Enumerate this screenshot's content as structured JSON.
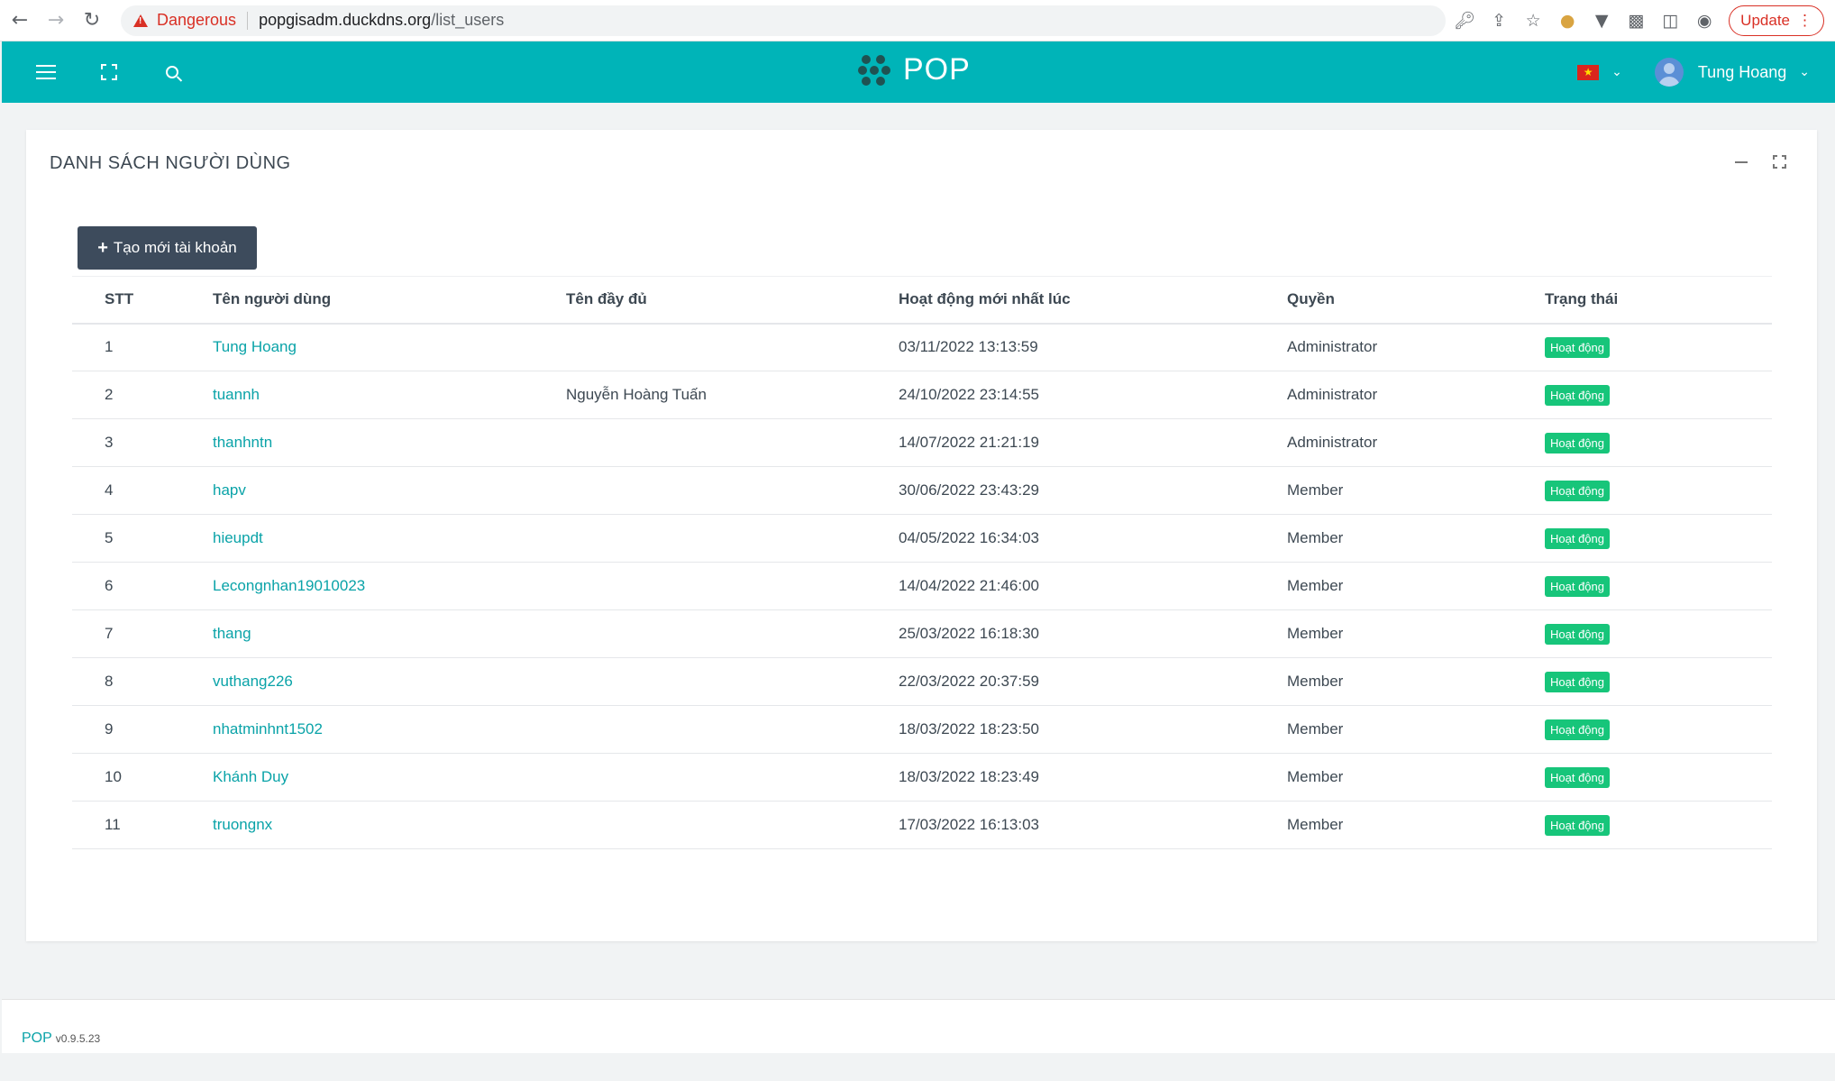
{
  "browser": {
    "back_icon": "arrow-left",
    "forward_icon": "arrow-right",
    "reload_icon": "reload",
    "security_label": "Dangerous",
    "url_host": "popgisadm.duckdns.org",
    "url_path": "/list_users",
    "update_label": "Update"
  },
  "header": {
    "brand": "POP",
    "user_name": "Tung Hoang",
    "accent_color": "#00b4b8"
  },
  "card": {
    "title": "DANH SÁCH NGƯỜI DÙNG",
    "create_button": "Tạo mới tài khoản"
  },
  "table": {
    "headers": [
      "STT",
      "Tên người dùng",
      "Tên đầy đủ",
      "Hoạt động mới nhất lúc",
      "Quyền",
      "Trạng thái"
    ],
    "rows": [
      {
        "stt": "1",
        "username": "Tung Hoang",
        "fullname": "",
        "last_active": "03/11/2022 13:13:59",
        "role": "Administrator",
        "status": "Hoạt động"
      },
      {
        "stt": "2",
        "username": "tuannh",
        "fullname": "Nguyễn Hoàng Tuấn",
        "last_active": "24/10/2022 23:14:55",
        "role": "Administrator",
        "status": "Hoạt động"
      },
      {
        "stt": "3",
        "username": "thanhntn",
        "fullname": "",
        "last_active": "14/07/2022 21:21:19",
        "role": "Administrator",
        "status": "Hoạt động"
      },
      {
        "stt": "4",
        "username": "hapv",
        "fullname": "",
        "last_active": "30/06/2022 23:43:29",
        "role": "Member",
        "status": "Hoạt động"
      },
      {
        "stt": "5",
        "username": "hieupdt",
        "fullname": "",
        "last_active": "04/05/2022 16:34:03",
        "role": "Member",
        "status": "Hoạt động"
      },
      {
        "stt": "6",
        "username": "Lecongnhan19010023",
        "fullname": "",
        "last_active": "14/04/2022 21:46:00",
        "role": "Member",
        "status": "Hoạt động"
      },
      {
        "stt": "7",
        "username": "thang",
        "fullname": "",
        "last_active": "25/03/2022 16:18:30",
        "role": "Member",
        "status": "Hoạt động"
      },
      {
        "stt": "8",
        "username": "vuthang226",
        "fullname": "",
        "last_active": "22/03/2022 20:37:59",
        "role": "Member",
        "status": "Hoạt động"
      },
      {
        "stt": "9",
        "username": "nhatminhnt1502",
        "fullname": "",
        "last_active": "18/03/2022 18:23:50",
        "role": "Member",
        "status": "Hoạt động"
      },
      {
        "stt": "10",
        "username": "Khánh Duy",
        "fullname": "",
        "last_active": "18/03/2022 18:23:49",
        "role": "Member",
        "status": "Hoạt động"
      },
      {
        "stt": "11",
        "username": "truongnx",
        "fullname": "",
        "last_active": "17/03/2022 16:13:03",
        "role": "Member",
        "status": "Hoạt động"
      }
    ]
  },
  "footer": {
    "brand": "POP",
    "version": "v0.9.5.23"
  }
}
